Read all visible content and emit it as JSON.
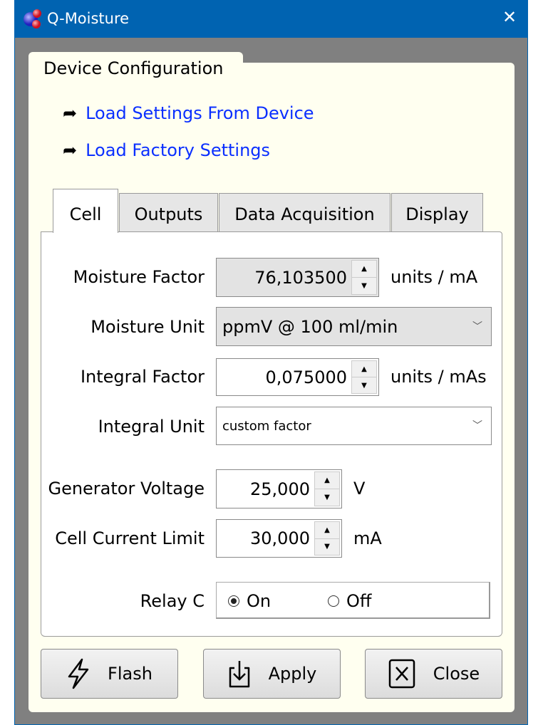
{
  "window": {
    "title": "Q-Moisture",
    "close_glyph": "✕",
    "accent": "#0063b1"
  },
  "group": {
    "title": "Device Configuration"
  },
  "links": [
    {
      "label": "Load Settings From Device",
      "icon": "share-arrow-icon"
    },
    {
      "label": "Load Factory Settings",
      "icon": "share-arrow-icon"
    }
  ],
  "tabs": [
    {
      "label": "Cell",
      "selected": true
    },
    {
      "label": "Outputs"
    },
    {
      "label": "Data Acquisition"
    },
    {
      "label": "Display"
    }
  ],
  "cell": {
    "moisture_factor": {
      "label": "Moisture Factor",
      "value": "76,103500",
      "unit": "units / mA"
    },
    "moisture_unit": {
      "label": "Moisture Unit",
      "value": "ppmV @ 100 ml/min"
    },
    "integral_factor": {
      "label": "Integral Factor",
      "value": "0,075000",
      "unit": "units / mAs"
    },
    "integral_unit": {
      "label": "Integral Unit",
      "value": "custom factor"
    },
    "generator_voltage": {
      "label": "Generator Voltage",
      "value": "25,000",
      "unit": "V"
    },
    "cell_current_limit": {
      "label": "Cell Current Limit",
      "value": "30,000",
      "unit": "mA"
    },
    "relay_c": {
      "label": "Relay C",
      "options": [
        "On",
        "Off"
      ],
      "selected": "On"
    }
  },
  "buttons": {
    "flash": "Flash",
    "apply": "Apply",
    "close": "Close"
  }
}
